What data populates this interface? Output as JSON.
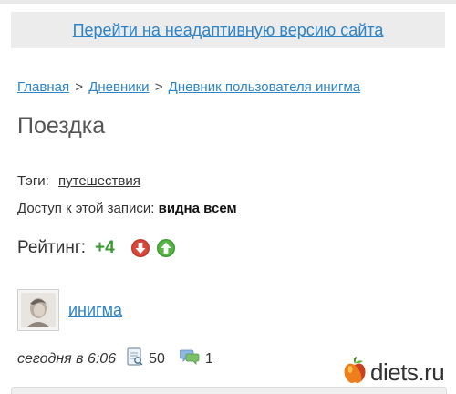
{
  "banner": {
    "link_text": "Перейти на неадаптивную версию сайта"
  },
  "breadcrumb": {
    "items": [
      "Главная",
      "Дневники",
      "Дневник пользователя инигма"
    ],
    "separator": ">"
  },
  "post": {
    "title": "Поездка",
    "tags_label": "Тэги:",
    "tag": "путешествия",
    "access_label": "Доступ к этой записи:",
    "access_value": "видна всем",
    "rating_label": "Рейтинг:",
    "rating_value": "+4",
    "author": "инигма",
    "date": "сегодня в 6:06",
    "views": "50",
    "comments": "1"
  },
  "logo": {
    "text": "diets.ru"
  },
  "colors": {
    "link": "#2e84c8",
    "rating_positive": "#3c9a33",
    "vote_down": "#c0392b",
    "vote_up": "#4aa83c"
  },
  "icons": {
    "vote_down": "arrow-down-icon",
    "vote_up": "arrow-up-icon",
    "views": "document-icon",
    "comments": "speech-bubbles-icon",
    "logo": "apple-icon"
  }
}
